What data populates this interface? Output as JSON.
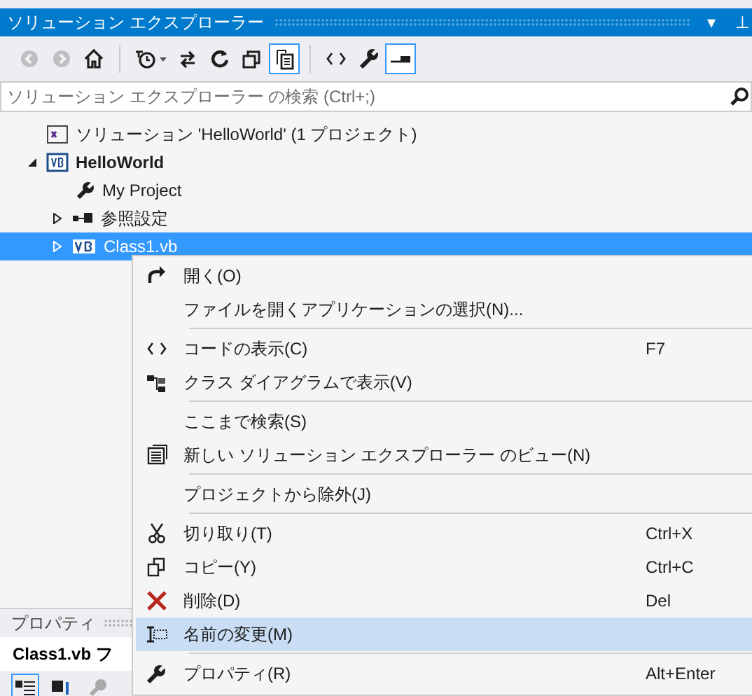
{
  "window": {
    "title": "ソリューション エクスプローラー",
    "dropdown": "▾",
    "pin": "⊥"
  },
  "toolbar": [
    {
      "kind": "button",
      "disabled": true,
      "pressed": false
    },
    {
      "kind": "button",
      "disabled": true,
      "pressed": false
    },
    {
      "kind": "button",
      "disabled": false,
      "pressed": false
    },
    {
      "kind": "separator"
    },
    {
      "kind": "dropdown",
      "disabled": false,
      "pressed": false
    },
    {
      "kind": "button",
      "disabled": false,
      "pressed": false
    },
    {
      "kind": "button",
      "disabled": false,
      "pressed": false
    },
    {
      "kind": "button",
      "disabled": false,
      "pressed": false
    },
    {
      "kind": "button",
      "disabled": false,
      "pressed": true
    },
    {
      "kind": "separator"
    },
    {
      "kind": "button",
      "disabled": false,
      "pressed": false
    },
    {
      "kind": "button",
      "disabled": false,
      "pressed": false
    },
    {
      "kind": "button",
      "disabled": false,
      "pressed": true
    }
  ],
  "search": {
    "placeholder": "ソリューション エクスプローラー の検索 (Ctrl+;)"
  },
  "tree": [
    {
      "label": "ソリューション 'HelloWorld' (1 プロジェクト)",
      "selected": false,
      "children": [
        {
          "label": "HelloWorld",
          "startup": true,
          "expanded": true,
          "selected": false,
          "children": [
            {
              "label": "My Project",
              "selected": false
            },
            {
              "label": "参照設定",
              "expanded": false,
              "selected": false
            },
            {
              "label": "Class1.vb",
              "expanded": false,
              "selected": true
            }
          ]
        }
      ]
    }
  ],
  "context_menu": [
    {
      "kind": "item",
      "label": "開く(O)",
      "selected": false
    },
    {
      "kind": "item",
      "label": "ファイルを開くアプリケーションの選択(N)...",
      "selected": false
    },
    {
      "kind": "separator"
    },
    {
      "kind": "item",
      "label": "コードの表示(C)",
      "shortcut": "F7",
      "selected": false
    },
    {
      "kind": "item",
      "label": "クラス ダイアグラムで表示(V)",
      "selected": false
    },
    {
      "kind": "separator"
    },
    {
      "kind": "item",
      "label": "ここまで検索(S)",
      "selected": false
    },
    {
      "kind": "item",
      "label": "新しい ソリューション エクスプローラー のビュー(N)",
      "selected": false
    },
    {
      "kind": "separator"
    },
    {
      "kind": "item",
      "label": "プロジェクトから除外(J)",
      "selected": false
    },
    {
      "kind": "separator"
    },
    {
      "kind": "item",
      "label": "切り取り(T)",
      "shortcut": "Ctrl+X",
      "selected": false
    },
    {
      "kind": "item",
      "label": "コピー(Y)",
      "shortcut": "Ctrl+C",
      "selected": false
    },
    {
      "kind": "item",
      "label": "削除(D)",
      "shortcut": "Del",
      "selected": false
    },
    {
      "kind": "item",
      "label": "名前の変更(M)",
      "selected": true
    },
    {
      "kind": "separator"
    },
    {
      "kind": "item",
      "label": "プロパティ(R)",
      "shortcut": "Alt+Enter",
      "selected": false
    }
  ],
  "properties": {
    "title": "プロパティ",
    "object": "Class1.vb フ"
  }
}
